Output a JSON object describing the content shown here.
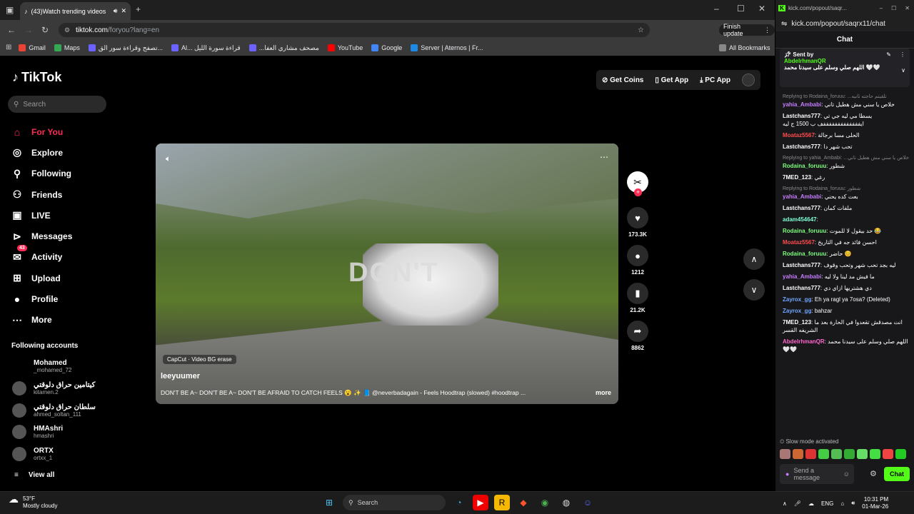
{
  "browser": {
    "tab_title": "(43)Watch trending videos",
    "url_host": "tiktok.com",
    "url_path": "/foryou?lang=en",
    "finish_update": "Finish update",
    "bookmarks": [
      {
        "label": "Gmail",
        "color": "#ea4335"
      },
      {
        "label": "Maps",
        "color": "#34a853"
      },
      {
        "label": "تصفح وقراءة سور الق...",
        "color": "#6c63ff"
      },
      {
        "label": "Al... قراءة سورة الليل",
        "color": "#6c63ff"
      },
      {
        "label": "...مصحف مشاري العفا",
        "color": "#6c63ff"
      },
      {
        "label": "YouTube",
        "color": "#ff0000"
      },
      {
        "label": "Google",
        "color": "#4285f4"
      },
      {
        "label": "Server | Aternos | Fr...",
        "color": "#1e88e5"
      }
    ],
    "all_bookmarks": "All Bookmarks"
  },
  "tiktok": {
    "logo": "TikTok",
    "search_placeholder": "Search",
    "nav": [
      {
        "label": "For You",
        "icon": "home-icon",
        "glyph": "⌂"
      },
      {
        "label": "Explore",
        "icon": "compass-icon",
        "glyph": "◎"
      },
      {
        "label": "Following",
        "icon": "following-icon",
        "glyph": "⚲"
      },
      {
        "label": "Friends",
        "icon": "friends-icon",
        "glyph": "⚇"
      },
      {
        "label": "LIVE",
        "icon": "live-icon",
        "glyph": "▣"
      },
      {
        "label": "Messages",
        "icon": "messages-icon",
        "glyph": "⊳"
      },
      {
        "label": "Activity",
        "icon": "activity-icon",
        "glyph": "✉"
      },
      {
        "label": "Upload",
        "icon": "upload-icon",
        "glyph": "⊞"
      },
      {
        "label": "Profile",
        "icon": "profile-icon",
        "glyph": "●"
      },
      {
        "label": "More",
        "icon": "more-icon",
        "glyph": "⋯"
      }
    ],
    "activity_badge": "43",
    "following_title": "Following accounts",
    "accounts": [
      {
        "name": "Mohamed",
        "handle": "_mohamed_72"
      },
      {
        "name": "كيتامين حراق دلوقتي",
        "handle": "kitamen.2"
      },
      {
        "name": "سلطان حراق دلوقتي",
        "handle": "ahmed_soltan_111"
      },
      {
        "name": "HMAshri",
        "handle": "hmashri"
      },
      {
        "name": "ORTX",
        "handle": "ortxx_1"
      }
    ],
    "view_all": "View all",
    "top_buttons": [
      "Get Coins",
      "Get App",
      "PC App"
    ],
    "video": {
      "overlay_text": "DON'T",
      "capcut": "CapCut · Video BG erase",
      "author": "leeyuumer",
      "description": "DON'T BE A~ DON'T BE A~ DON'T BE AFRAID TO CATCH FEELS 😮 ✨ 📘 @neverbadagain - Feels Hoodtrap (slowed) #hoodtrap ...",
      "more": "more"
    },
    "actions": [
      {
        "icon": "heart-icon",
        "glyph": "♥",
        "count": "173.3K"
      },
      {
        "icon": "comment-icon",
        "glyph": "●",
        "count": "1212"
      },
      {
        "icon": "bookmark-icon",
        "glyph": "▮",
        "count": "21.2K"
      },
      {
        "icon": "share-icon",
        "glyph": "➦",
        "count": "8862"
      }
    ]
  },
  "kick": {
    "url": "kick.com/popout/saqrx11/chat",
    "title_url": "kick.com/popout/saqr...",
    "header": "Chat",
    "pinned_label": "Sent by",
    "pinned_user": "AbdelrhmanQR",
    "pinned_msg": "اللهم صلي وسلم على سيدنا محمد 🤍🤍",
    "messages": [
      {
        "reply": "Replying to Rodaina_foruuu: ...تلقيتم حاجته ثانيه",
        "user": "yahia_Ambabi",
        "color": "#c77dff",
        "text": "خلاص يا سني مش هطيل تاني"
      },
      {
        "reply": "",
        "user": "Lastchans777",
        "color": "#ffffff",
        "text": "يسطا مي ليه جي تي ايفففففففففففففف ب 1500 ج ليه"
      },
      {
        "reply": "",
        "user": "Moataz5567",
        "color": "#ff4d4d",
        "text": "الحلى مسا برجالة"
      },
      {
        "reply": "",
        "user": "Lastchans777",
        "color": "#ffffff",
        "text": "تحب شهر دا"
      },
      {
        "reply": "Replying to yahia_Ambabi: ...خلاص يا سني مش هطيل تاني",
        "user": "Rodaina_foruuu",
        "color": "#7dff7d",
        "text": "شطور"
      },
      {
        "reply": "",
        "user": "7MED_123",
        "color": "#ffffff",
        "text": "رغي"
      },
      {
        "reply": "Replying to Rodaina_foruuu: شطور",
        "user": "yahia_Ambabi",
        "color": "#c77dff",
        "text": "بعت كده يحني"
      },
      {
        "reply": "",
        "user": "Lastchans777",
        "color": "#ffffff",
        "text": "ملفات كمان"
      },
      {
        "reply": "",
        "user": "adam454647",
        "color": "#7dffd4",
        "text": ""
      },
      {
        "reply": "",
        "user": "Rodaina_foruuu",
        "color": "#7dff7d",
        "text": "حد بيقول لا للموت 😂"
      },
      {
        "reply": "",
        "user": "Moataz5567",
        "color": "#ff4d4d",
        "text": "احسن فائد جه في التاريخ"
      },
      {
        "reply": "",
        "user": "Rodaina_foruuu",
        "color": "#7dff7d",
        "text": "حاضر 😊"
      },
      {
        "reply": "",
        "user": "Lastchans777",
        "color": "#ffffff",
        "text": "ليه بجد تحب شهر وتحب وقوف"
      },
      {
        "reply": "",
        "user": "yahia_Ambabi",
        "color": "#c77dff",
        "text": "ما فيش مد لينا ولا ليه"
      },
      {
        "reply": "",
        "user": "Lastchans777",
        "color": "#ffffff",
        "text": "دي هشتريها ازاي دي"
      },
      {
        "reply": "",
        "user": "Zayrox_gg",
        "color": "#6fa8ff",
        "text": "Eh ya ragl ya 7osa? (Deleted)"
      },
      {
        "reply": "",
        "user": "Zayrox_gg",
        "color": "#6fa8ff",
        "text": "bahzar"
      },
      {
        "reply": "",
        "user": "7MED_123",
        "color": "#ffffff",
        "text": "انت مصدقش تقعدوا في الحارة بعد ما الشريفه القسر"
      },
      {
        "reply": "",
        "user": "AbdelrhmanQR",
        "color": "#ff66cc",
        "text": "اللهم صلي وسلم على سيدنا محمد 🤍🤍"
      }
    ],
    "slow_mode": "Slow mode activated",
    "send_placeholder": "Send a message",
    "chat_button": "Chat"
  },
  "taskbar": {
    "temp": "53°F",
    "weather": "Mostly cloudy",
    "search": "Search",
    "lang": "ENG",
    "time": "10:31 PM",
    "date": "01-Mar-26"
  }
}
